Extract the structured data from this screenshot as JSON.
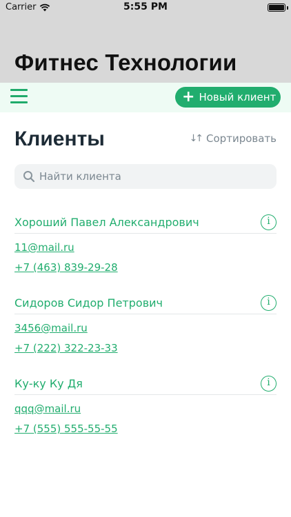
{
  "status_bar": {
    "carrier": "Carrier",
    "time": "5:55 PM"
  },
  "app": {
    "title": "Фитнес Технологии"
  },
  "toolbar": {
    "menu_icon": "hamburger-menu-icon",
    "new_client_label": "Новый клиент"
  },
  "main": {
    "title": "Клиенты",
    "sort_label": "Сортировать",
    "search_placeholder": "Найти клиента"
  },
  "clients": [
    {
      "name": "Хороший Павел Александрович",
      "email": "11@mail.ru",
      "phone": "+7 (463) 839-29-28"
    },
    {
      "name": "Сидоров Сидор Петрович",
      "email": "3456@mail.ru",
      "phone": "+7 (222) 322-23-33"
    },
    {
      "name": "Ку-ку Ку Дя",
      "email": "qqq@mail.ru",
      "phone": "+7 (555) 555-55-55"
    }
  ],
  "colors": {
    "accent": "#21ad6e",
    "header_bg": "#d8d8d8",
    "toolbar_bg": "#eefbf4"
  }
}
